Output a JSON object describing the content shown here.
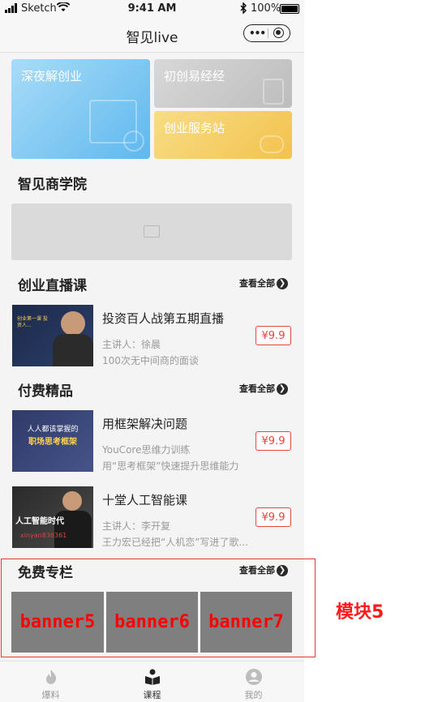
{
  "status_bar": {
    "carrier": "Sketch",
    "time": "9:41 AM",
    "battery": "100%"
  },
  "nav": {
    "title": "智见live"
  },
  "grid": {
    "tile1": "深夜解创业",
    "tile2": "初创易经经",
    "tile3": "创业服务站"
  },
  "sections": {
    "academy": "智见商学院",
    "live": "创业直播课",
    "paid": "付费精品",
    "free": "免费专栏",
    "see_all": "查看全部"
  },
  "live_courses": [
    {
      "title": "投资百人战第五期直播",
      "line2": "主讲人：徐晨",
      "line3": "100次无中间商的面谈",
      "price": "¥9.9",
      "thumb_text": "创业第一课 投资人..."
    }
  ],
  "paid_courses": [
    {
      "title": "用框架解决问题",
      "line2": "YouCore思维力训练",
      "line3": "用“思考框架”快速提升思维能力",
      "price": "¥9.9",
      "thumb_line1": "人人都该掌握的",
      "thumb_line2": "职场思考框架"
    },
    {
      "title": "十堂人工智能课",
      "line2": "主讲人：李开复",
      "line3": "王力宏已经把“人机恋”写进了歌...",
      "price": "¥9.9",
      "thumb_line1": "人工智能时代",
      "thumb_line2": "xinyan836361"
    }
  ],
  "free_banners": [
    "banner5",
    "banner6",
    "banner7"
  ],
  "module_label": "模块5",
  "tabs": [
    {
      "label": "爆料",
      "icon": "fire-icon"
    },
    {
      "label": "课程",
      "icon": "book-reader-icon"
    },
    {
      "label": "我的",
      "icon": "user-icon"
    }
  ],
  "colors": {
    "price_red": "#e8443c",
    "annotation_red": "#e53935"
  }
}
